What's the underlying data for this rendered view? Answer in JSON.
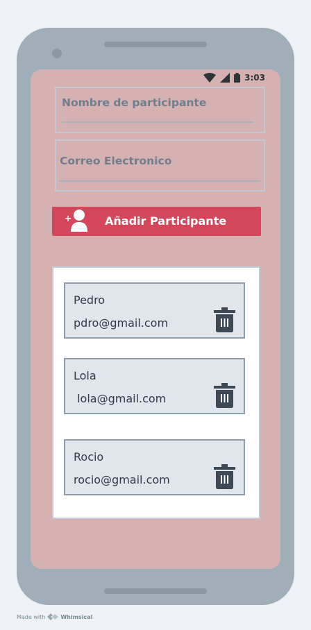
{
  "status_bar": {
    "time": "3:03"
  },
  "form": {
    "name_placeholder": "Nombre de participante",
    "email_placeholder": "Correo Electronico",
    "add_button_label": "Añadir Participante"
  },
  "participants": [
    {
      "name": "Pedro",
      "email": "pdro@gmail.com"
    },
    {
      "name": "Lola",
      "email": " lola@gmail.com"
    },
    {
      "name": "Rocio",
      "email": "rocio@gmail.com"
    }
  ],
  "footer": {
    "made_with": "Made with",
    "brand": "Whimsical"
  },
  "colors": {
    "screen_bg": "#d6b1b1",
    "accent": "#d4465a",
    "device": "#a0aeba",
    "card_bg": "#e1e5ec",
    "icon": "#3d4a56"
  },
  "icons": [
    "wifi-icon",
    "signal-icon",
    "battery-icon",
    "add-user-icon",
    "trash-icon",
    "whimsical-logo-icon"
  ]
}
